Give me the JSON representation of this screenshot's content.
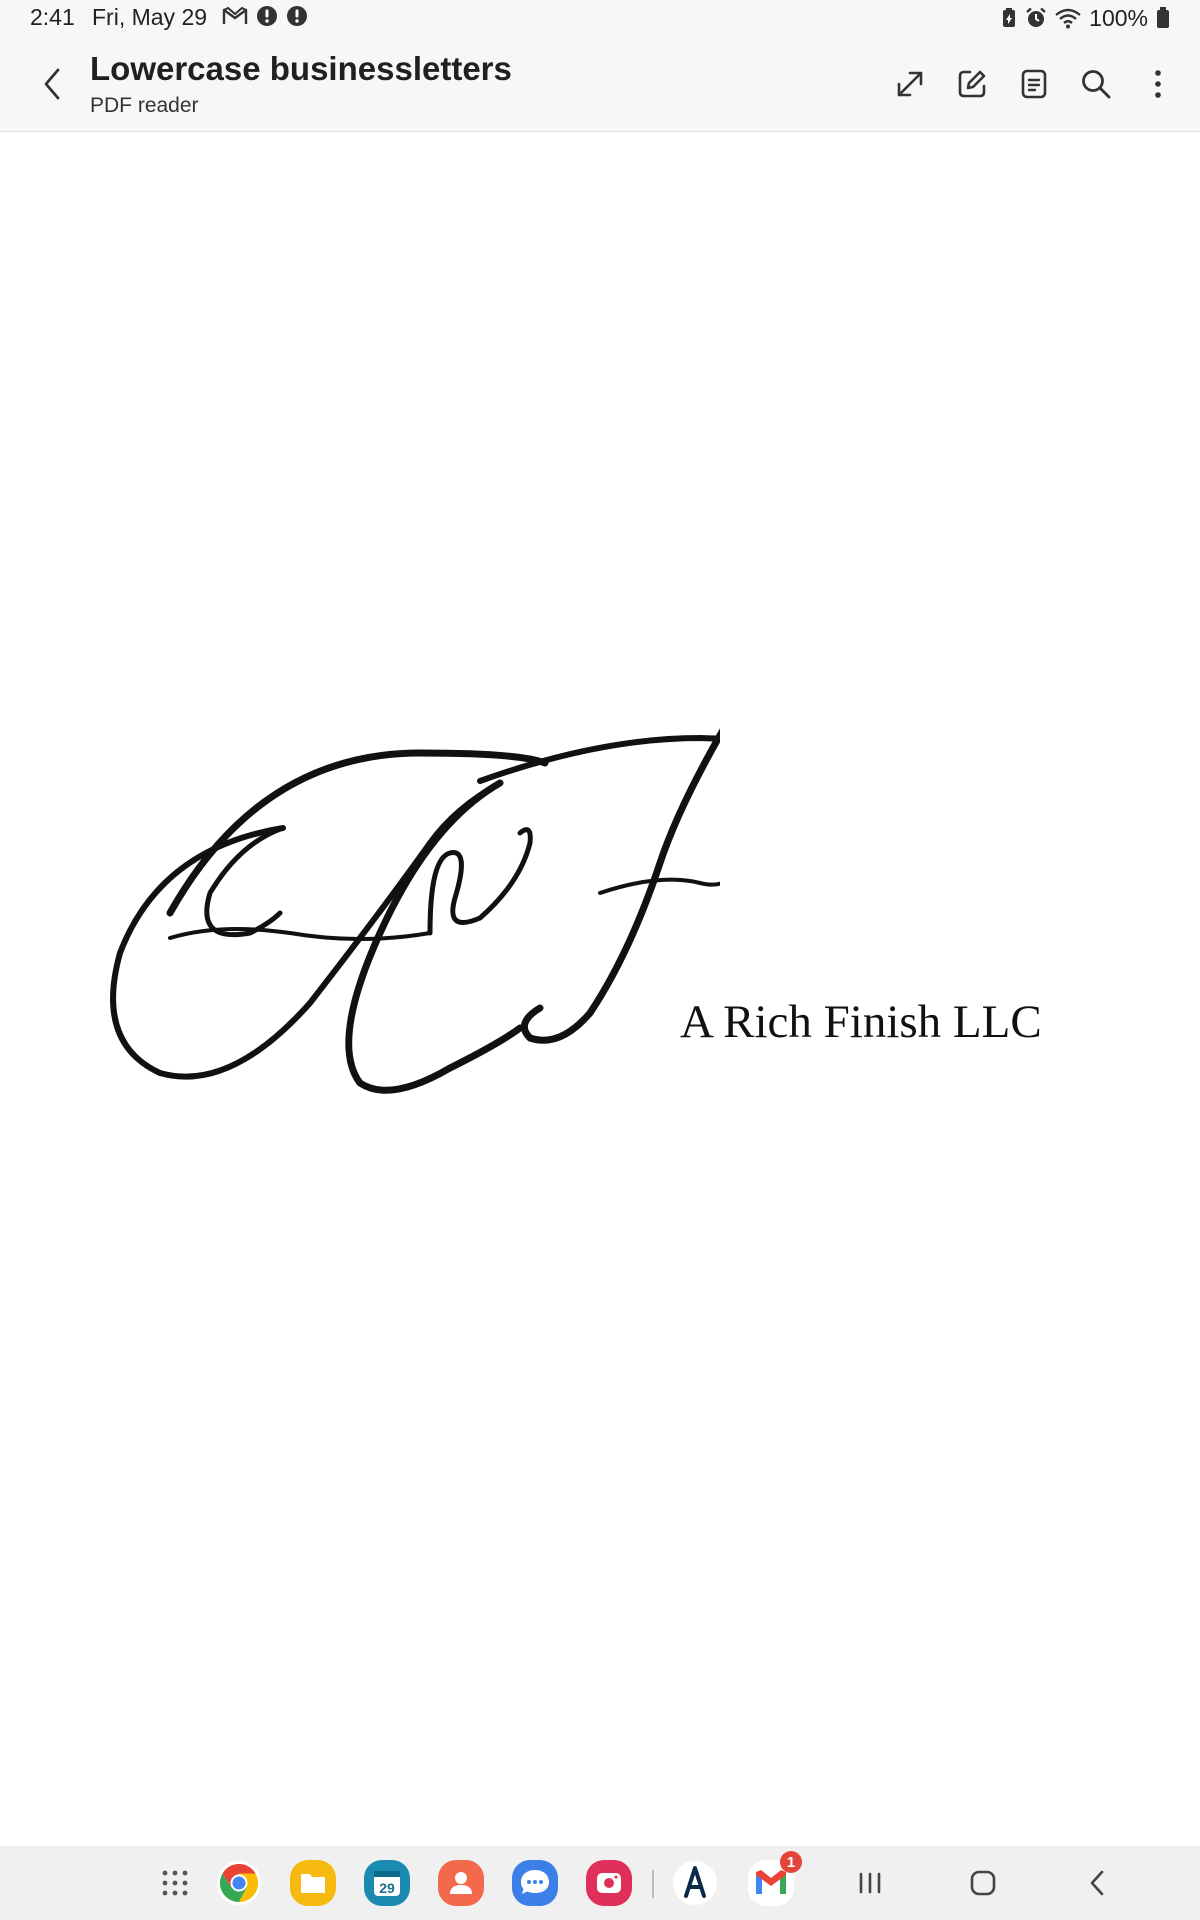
{
  "status_bar": {
    "time": "2:41",
    "date": "Fri, May 29",
    "notification_icons": [
      "gmail-icon",
      "alert-icon",
      "alert-icon"
    ],
    "system_icons": [
      "battery-saver-icon",
      "alarm-icon",
      "wifi-icon"
    ],
    "battery": "100%"
  },
  "app_bar": {
    "title": "Lowercase businessletters",
    "subtitle": "PDF reader",
    "actions": [
      "expand-icon",
      "edit-icon",
      "reading-mode-icon",
      "search-icon",
      "more-options-icon"
    ]
  },
  "document": {
    "logo_monogram": "ArF",
    "company_name": "A Rich Finish LLC"
  },
  "taskbar": {
    "apps": [
      {
        "name": "app-drawer",
        "color": "#555555"
      },
      {
        "name": "chrome",
        "color": "#4285f4"
      },
      {
        "name": "my-files",
        "color": "#f6b910"
      },
      {
        "name": "calendar",
        "color": "#1a8ab0",
        "label": "29"
      },
      {
        "name": "contacts",
        "color": "#f26a4b"
      },
      {
        "name": "messages",
        "color": "#3d7fe8"
      },
      {
        "name": "screen-recorder",
        "color": "#e0305a"
      },
      {
        "name": "adobe-acrobat",
        "color": "#0b2a4a"
      },
      {
        "name": "gmail",
        "color": "#ea4335",
        "badge": "1"
      }
    ],
    "nav": [
      "recents-icon",
      "home-icon",
      "back-icon"
    ]
  }
}
